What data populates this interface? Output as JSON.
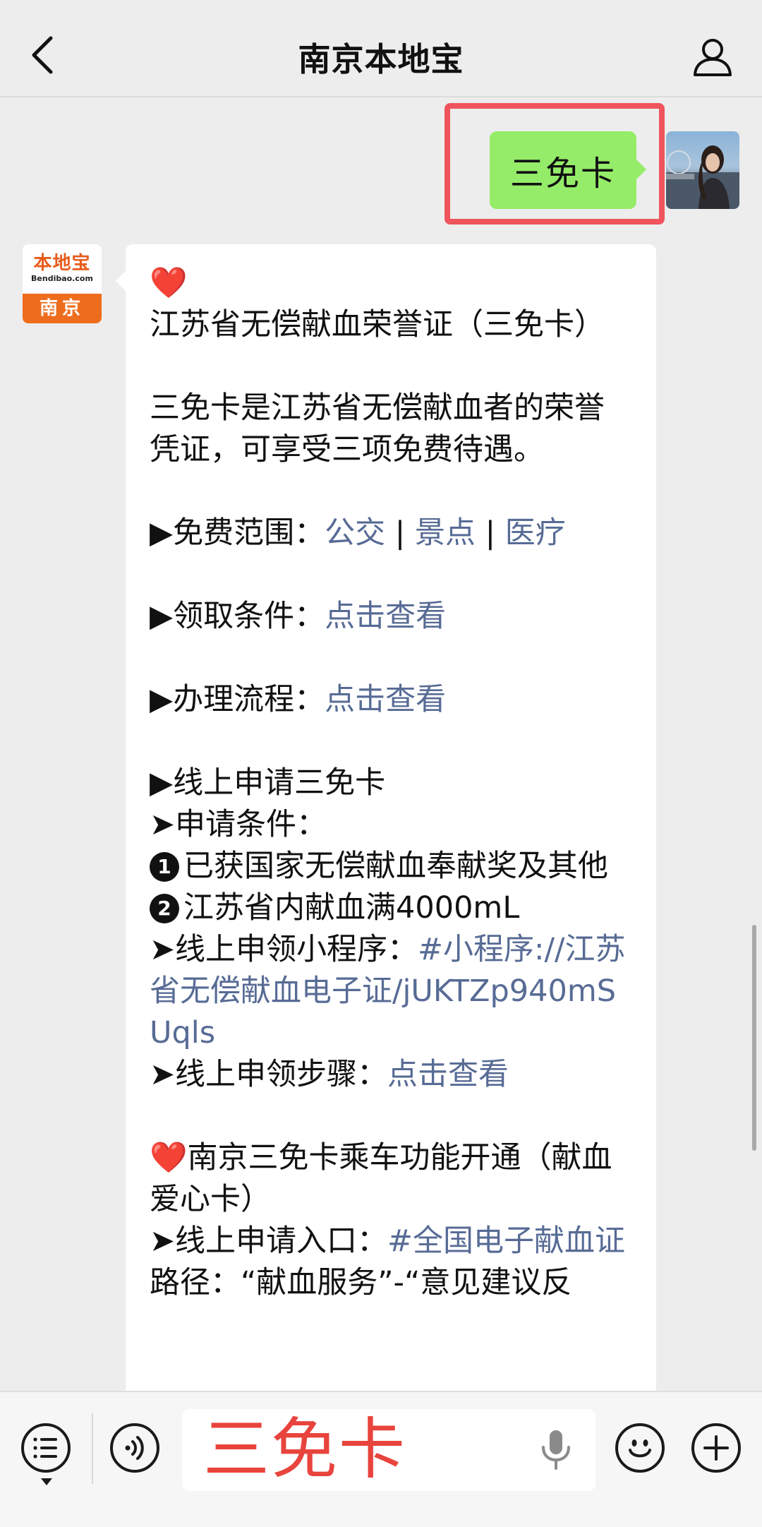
{
  "header": {
    "title": "南京本地宝",
    "back_icon": "chevron-left-icon",
    "profile_icon": "user-icon"
  },
  "outgoing_message": {
    "text": "三免卡",
    "bubble_color": "#95ec69",
    "highlight_color": "#f0545c"
  },
  "bot_avatar": {
    "brand": "本地宝",
    "domain": "Bendibao.com",
    "city": "南京"
  },
  "reply": {
    "heart_1": "❤️",
    "heading_1": "江苏省无偿献血荣誉证（三免卡）",
    "intro": "三免卡是江苏省无偿献血者的荣誉凭证，可享受三项免费待遇。",
    "scope_label": "▶免费范围：",
    "scope_links": [
      "公交",
      "景点",
      "医疗"
    ],
    "scope_sep": " | ",
    "conditions_label": "▶领取条件：",
    "conditions_link": "点击查看",
    "process_label": "▶办理流程：",
    "process_link": "点击查看",
    "online_title": "▶线上申请三免卡",
    "apply_cond_label": "➤申请条件：",
    "cond_1_num": "1",
    "cond_1": "已获国家无偿献血奉献奖及其他",
    "cond_2_num": "2",
    "cond_2": "江苏省内献血满4000mL",
    "miniprogram_label": "➤线上申领小程序：",
    "miniprogram_link": "#小程序://江苏省无偿献血电子证/jUKTZp940mSUqls",
    "steps_label": "➤线上申领步骤：",
    "steps_link": "点击查看",
    "heart_2": "❤️",
    "heading_2": "南京三免卡乘车功能开通（献血爱心卡）",
    "entry_label": "➤线上申请入口：",
    "entry_link": "#全国电子献血证",
    "path_text": "路径：“献血服务”-“意见建议反",
    "link_color": "#576b95"
  },
  "input_bar": {
    "menu_icon": "menu-list-icon",
    "voice_icon": "voice-icon",
    "input_value": "三免卡",
    "mic_icon": "mic-icon",
    "emoji_icon": "emoji-icon",
    "plus_icon": "plus-icon"
  }
}
